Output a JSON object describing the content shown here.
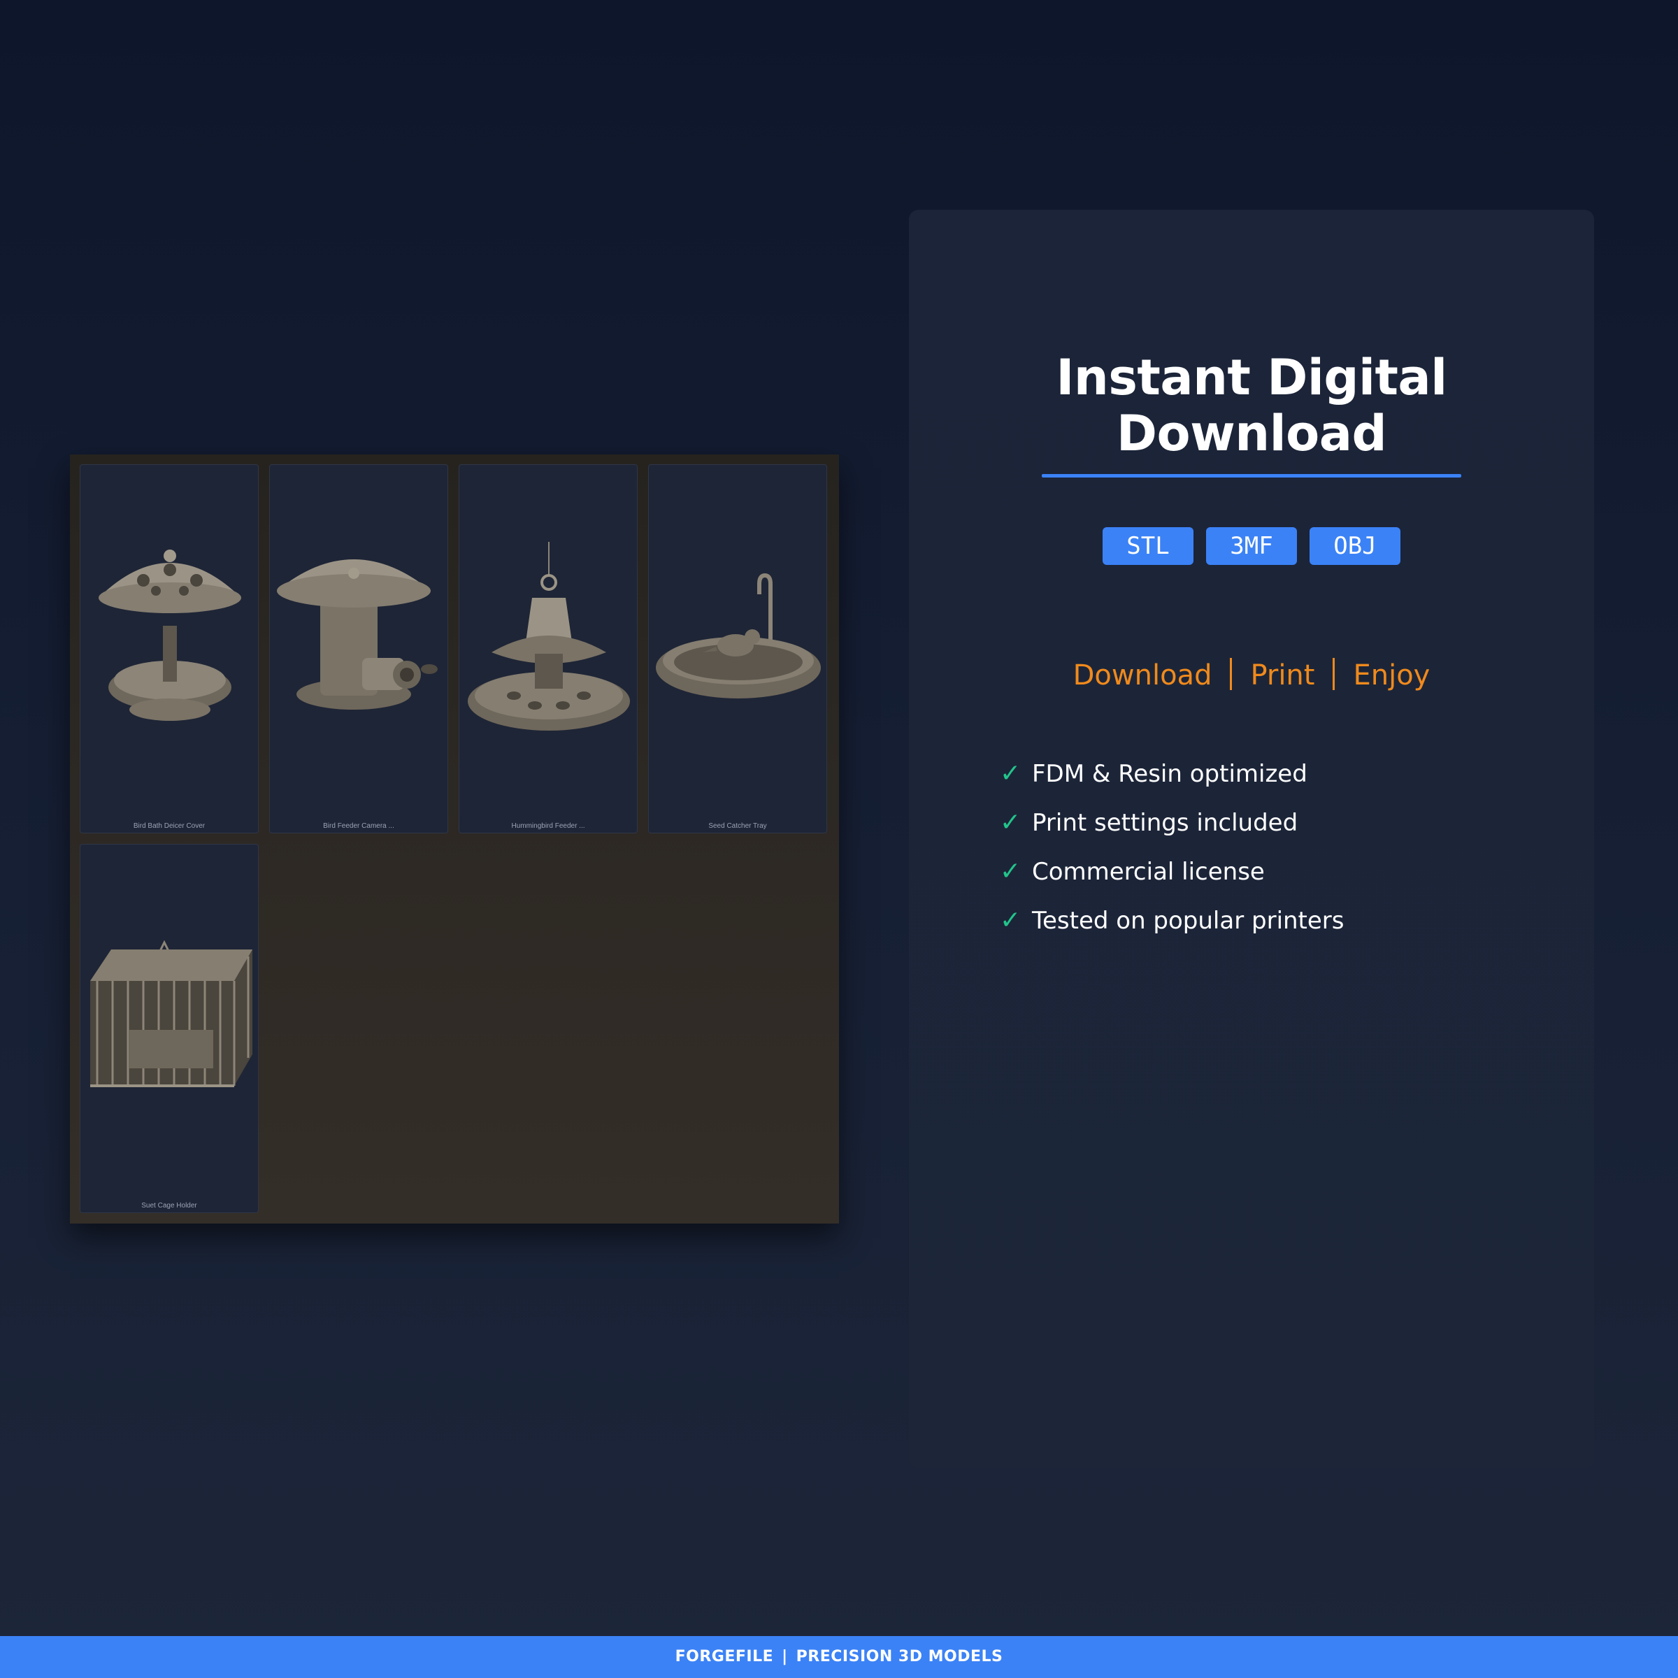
{
  "gallery": {
    "items": [
      {
        "label": "Bird Bath Deicer Cover"
      },
      {
        "label": "Bird Feeder Camera ..."
      },
      {
        "label": "Hummingbird Feeder ..."
      },
      {
        "label": "Seed Catcher Tray"
      },
      {
        "label": "Suet Cage Holder"
      }
    ]
  },
  "panel": {
    "title_line1": "Instant Digital",
    "title_line2": "Download",
    "formats": [
      "STL",
      "3MF",
      "OBJ"
    ],
    "tagline": [
      "Download",
      "Print",
      "Enjoy"
    ],
    "features": [
      "FDM & Resin optimized",
      "Print settings included",
      "Commercial license",
      "Tested on popular printers"
    ]
  },
  "footer": {
    "brand": "FORGEFILE",
    "separator": "|",
    "subtitle": "PRECISION 3D MODELS"
  },
  "colors": {
    "accent": "#3b82f6",
    "tagline": "#f08a1c",
    "check": "#22c58b"
  }
}
